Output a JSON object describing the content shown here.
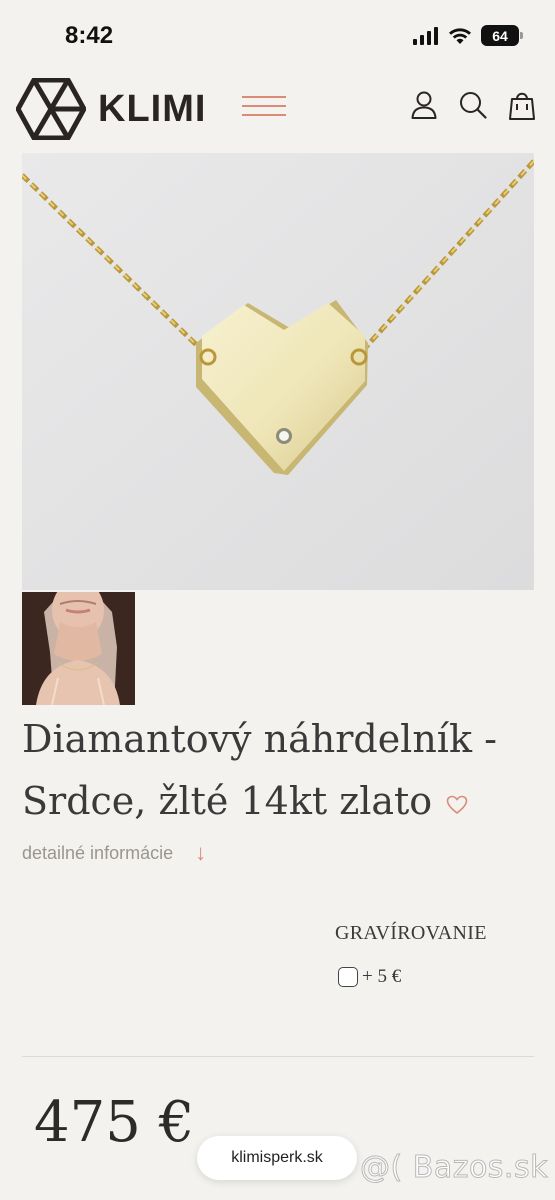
{
  "status_bar": {
    "time": "8:42",
    "battery": "64",
    "icons": [
      "signal-icon",
      "wifi-icon",
      "battery-icon"
    ]
  },
  "header": {
    "brand": "KLIMI",
    "icons": [
      "menu-icon",
      "user-icon",
      "search-icon",
      "bag-icon"
    ],
    "accent_color": "#d98b78"
  },
  "product": {
    "title_line1": "Diamantový náhrdelník -",
    "title_line2": "Srdce, žlté 14kt zlato",
    "details_link": "detailné informácie",
    "engraving_label": "GRAVÍROVANIE",
    "engraving_price": "+ 5 €",
    "price": "475 €"
  },
  "browser": {
    "url": "klimisperk.sk"
  },
  "watermark": "@( Bazos.sk"
}
